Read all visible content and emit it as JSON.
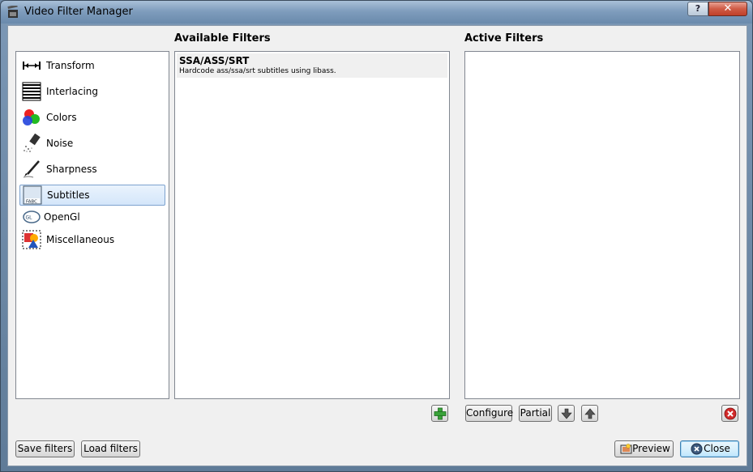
{
  "window": {
    "title": "Video Filter Manager",
    "help_glyph": "?",
    "close_glyph": "✕"
  },
  "headings": {
    "available": "Available Filters",
    "active": "Active Filters"
  },
  "categories": [
    {
      "label": "Transform",
      "icon": "transform-icon"
    },
    {
      "label": "Interlacing",
      "icon": "interlacing-icon"
    },
    {
      "label": "Colors",
      "icon": "colors-icon"
    },
    {
      "label": "Noise",
      "icon": "noise-icon"
    },
    {
      "label": "Sharpness",
      "icon": "sharpness-icon"
    },
    {
      "label": "Subtitles",
      "icon": "subtitles-icon",
      "selected": true
    },
    {
      "label": "OpenGl",
      "icon": "opengl-icon"
    },
    {
      "label": "Miscellaneous",
      "icon": "miscellaneous-icon"
    }
  ],
  "available_filters": [
    {
      "name": "SSA/ASS/SRT",
      "description": "Hardcode ass/ssa/srt subtitles using libass."
    }
  ],
  "buttons": {
    "configure": "Configure",
    "partial": "Partial",
    "save_filters": "Save filters",
    "load_filters": "Load filters",
    "preview": "Preview",
    "close": "Close"
  },
  "colors": {
    "selection_bg": "#d4e6fa",
    "add_green": "#3aa33a",
    "remove_red": "#d22a2a"
  }
}
